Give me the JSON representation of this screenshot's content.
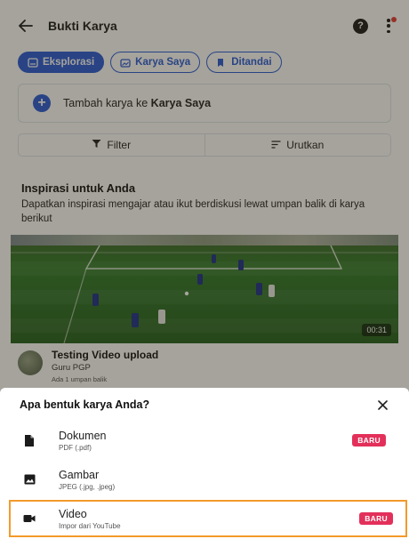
{
  "appbar": {
    "title": "Bukti Karya",
    "help_glyph": "?"
  },
  "tabs": [
    {
      "label": "Eksplorasi",
      "icon": "gallery-icon",
      "active": true
    },
    {
      "label": "Karya Saya",
      "icon": "image-stack-icon",
      "active": false
    },
    {
      "label": "Ditandai",
      "icon": "bookmark-icon",
      "active": false
    }
  ],
  "add_card": {
    "prefix": "Tambah karya ke ",
    "target": "Karya Saya"
  },
  "toolbar": {
    "filter_label": "Filter",
    "sort_label": "Urutkan"
  },
  "inspiration": {
    "title": "Inspirasi untuk Anda",
    "description": "Dapatkan inspirasi mengajar atau ikut berdiskusi lewat umpan balik di karya berikut"
  },
  "video": {
    "duration": "00:31"
  },
  "post": {
    "title": "Testing Video upload",
    "role": "Guru PGP",
    "feedback": "Ada 1 umpan balik"
  },
  "sheet": {
    "question": "Apa bentuk karya Anda?",
    "options": [
      {
        "label": "Dokumen",
        "sub": "PDF (.pdf)",
        "badge": "BARU",
        "icon": "document-icon"
      },
      {
        "label": "Gambar",
        "sub": "JPEG (.jpg, .jpeg)",
        "badge": "",
        "icon": "image-icon"
      },
      {
        "label": "Video",
        "sub": "Impor dari YouTube",
        "badge": "BARU",
        "icon": "video-camera-icon"
      }
    ]
  },
  "colors": {
    "primary": "#2a5bd7",
    "badge": "#e3305a",
    "selected_outline": "#f39a2a"
  }
}
